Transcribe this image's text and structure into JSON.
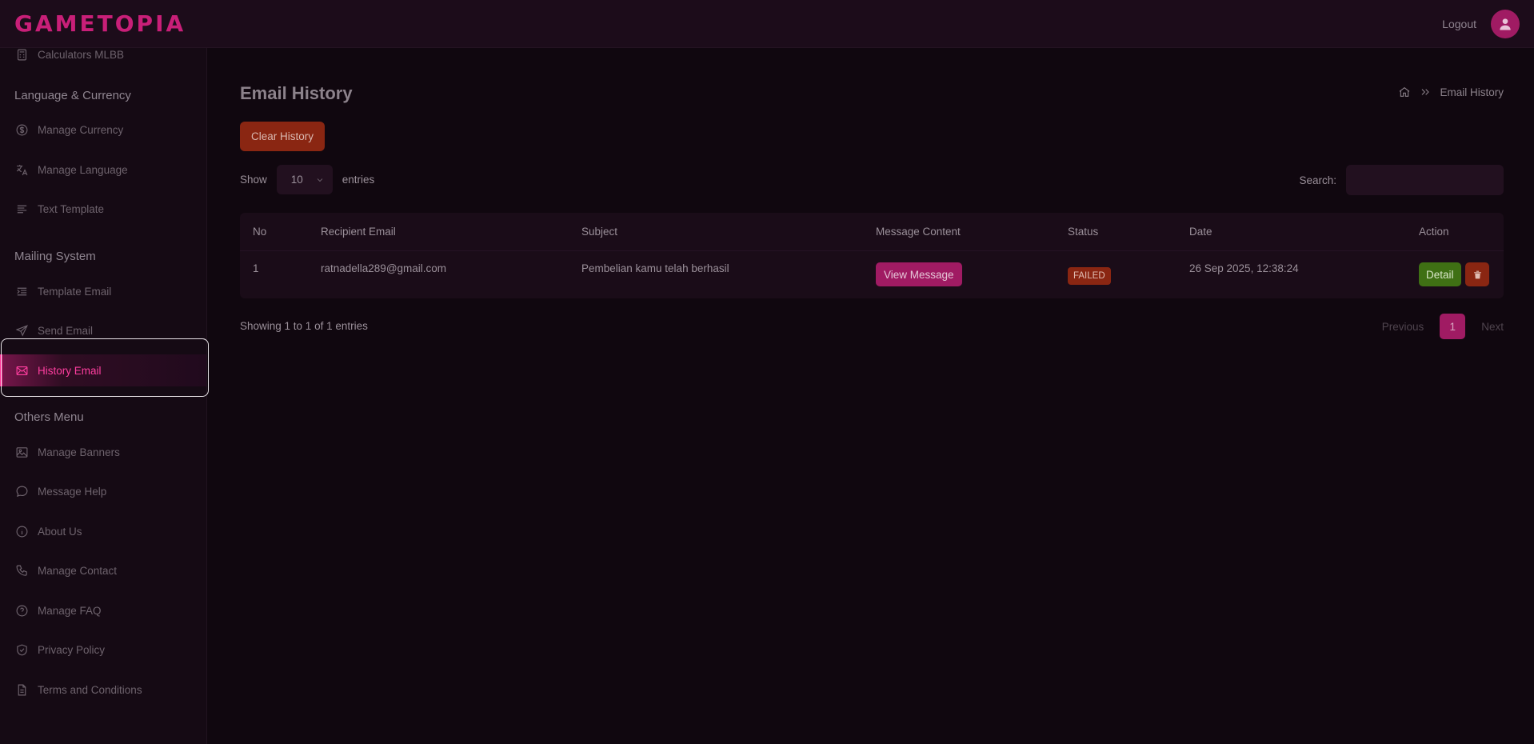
{
  "header": {
    "logo": "GAMETOPIA",
    "logout_label": "Logout"
  },
  "sidebar": {
    "partial_item": "Calculators MLBB",
    "sections": [
      {
        "title": "Language & Currency",
        "items": [
          {
            "label": "Manage Currency",
            "icon": "dollar-circle-icon"
          },
          {
            "label": "Manage Language",
            "icon": "translate-icon"
          },
          {
            "label": "Text Template",
            "icon": "align-left-icon"
          }
        ]
      },
      {
        "title": "Mailing System",
        "items": [
          {
            "label": "Template Email",
            "icon": "list-indent-icon"
          },
          {
            "label": "Send Email",
            "icon": "send-icon"
          },
          {
            "label": "History Email",
            "icon": "mail-icon",
            "active": true
          }
        ]
      },
      {
        "title": "Others Menu",
        "items": [
          {
            "label": "Manage Banners",
            "icon": "image-icon"
          },
          {
            "label": "Message Help",
            "icon": "chat-icon"
          },
          {
            "label": "About Us",
            "icon": "info-icon"
          },
          {
            "label": "Manage Contact",
            "icon": "phone-icon"
          },
          {
            "label": "Manage FAQ",
            "icon": "help-icon"
          },
          {
            "label": "Privacy Policy",
            "icon": "shield-check-icon"
          },
          {
            "label": "Terms and Conditions",
            "icon": "document-icon"
          }
        ]
      }
    ]
  },
  "main": {
    "title": "Email History",
    "breadcrumb_current": "Email History",
    "clear_button": "Clear History",
    "show_label": "Show",
    "entries_value": "10",
    "entries_label": "entries",
    "search_label": "Search:",
    "table": {
      "headers": [
        "No",
        "Recipient Email",
        "Subject",
        "Message Content",
        "Status",
        "Date",
        "Action"
      ],
      "rows": [
        {
          "no": "1",
          "email": "ratnadella289@gmail.com",
          "subject": "Pembelian kamu telah berhasil",
          "content_button": "View Message",
          "status": "FAILED",
          "date": "26 Sep 2025, 12:38:24",
          "detail_button": "Detail"
        }
      ]
    },
    "showing_text": "Showing 1 to 1 of 1 entries",
    "pagination": {
      "previous": "Previous",
      "current": "1",
      "next": "Next"
    }
  },
  "colors": {
    "accent": "#c81f78",
    "active_text": "#ff3ea0",
    "danger": "#8a2612",
    "success": "#3f7014"
  }
}
